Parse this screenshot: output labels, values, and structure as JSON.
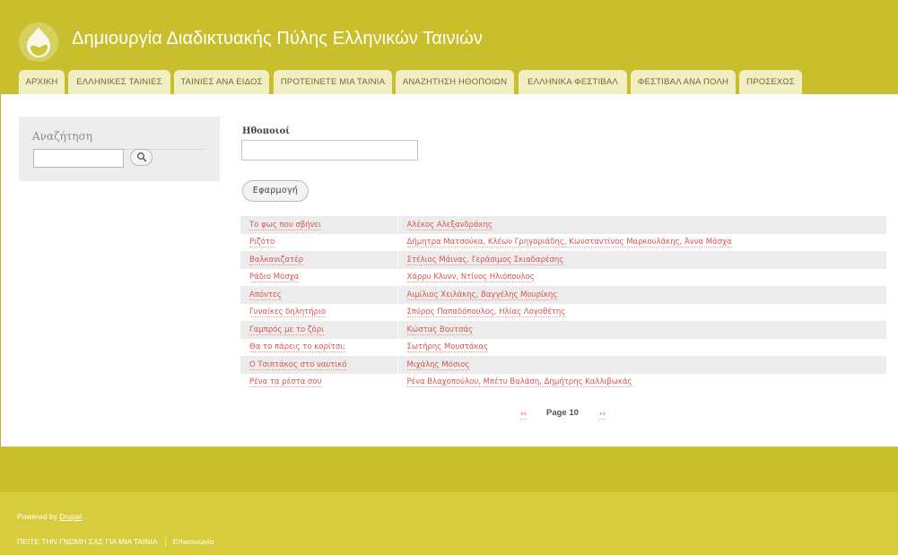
{
  "header": {
    "site_title": "Δημιουργία Διαδικτυακής Πύλης Ελληνικών Ταινιών",
    "logo_icon": "drupal-drop-icon"
  },
  "tabs": [
    {
      "label": "ΑΡΧΙΚΗ"
    },
    {
      "label": "ΕΛΛΗΝΙΚΕΣ ΤΑΙΝΙΕΣ"
    },
    {
      "label": "ΤΑΙΝΙΕΣ ΑΝΑ ΕΙΔΟΣ"
    },
    {
      "label": "ΠΡΟΤΕΙΝΕΤΕ ΜΙΑ ΤΑΙΝΙΑ"
    },
    {
      "label": "ΑΝΑΖΗΤΗΣΗ ΗΘΟΠΟΙΩΝ"
    },
    {
      "label": "ΕΛΛΗΝΙΚΑ ΦΕΣΤΙΒΑΛ"
    },
    {
      "label": "ΦΕΣΤΙΒΑΛ ΑΝΑ ΠΟΛΗ"
    },
    {
      "label": "ΠΡΟΣΕΧΩΣ"
    }
  ],
  "sidebar": {
    "title": "Αναζήτηση",
    "search_value": "",
    "search_icon": "search-icon"
  },
  "filter": {
    "label": "Ηθοποιοί",
    "value": "",
    "apply_label": "Εφαρμογή"
  },
  "results": [
    {
      "title": "Το φως που σβήνει",
      "actors": "Αλέκος Αλεξανδράκης"
    },
    {
      "title": "Ριζότο",
      "actors": "Δήμητρα Ματσούκα, Κλέων Γρηγοριάδης, Κωνσταντίνος Μαρκουλάκης, Άννα Μάσχα"
    },
    {
      "title": "Βαλκανιζατέρ",
      "actors": "Στέλιος Μάινας, Γεράσιμος Σκιαδαρέσης"
    },
    {
      "title": "Ράδιο Μόσχα",
      "actors": "Χάρρυ Κλυνν, Ντίνος Ηλιόπουλος"
    },
    {
      "title": "Απόντες",
      "actors": "Αιμίλιος Χειλάκης, Βαγγέλης Μουρίκης"
    },
    {
      "title": "Γυναίκες δηλητήριο",
      "actors": "Σπύρος Παπαδόπουλος, Ηλίας Λογοθέτης"
    },
    {
      "title": "Γαμπρός με το ζόρι",
      "actors": "Κώστας Βουτσάς"
    },
    {
      "title": "Θα το πάρεις το κορίτσι;",
      "actors": "Σωτήρης Μουστάκας"
    },
    {
      "title": "Ο Τσιπτάκος στο ναυτικό",
      "actors": "Μιχάλης Μόσιος"
    },
    {
      "title": "Ρένα τα ρέστα σου",
      "actors": "Ρένα Βλαχοπούλου, Μπέτυ Βαλάση, Δημήτρης Καλλιβωκάς"
    }
  ],
  "pager": {
    "prev": "‹‹",
    "label": "Page 10",
    "next": "››"
  },
  "footer": {
    "powered_prefix": "Powered by ",
    "powered_link": "Drupal",
    "links": [
      "ΠΕΙΤΕ ΤΗΝ ΓΝΩΜΗ ΣΑΣ ΓΙΑ ΜΙΑ ΤΑΙΝΙΑ",
      "Επικοινωνία"
    ]
  },
  "colors": {
    "header": "#c9bf2c",
    "tab_bg": "#f2eec4",
    "link": "#d9534f"
  }
}
